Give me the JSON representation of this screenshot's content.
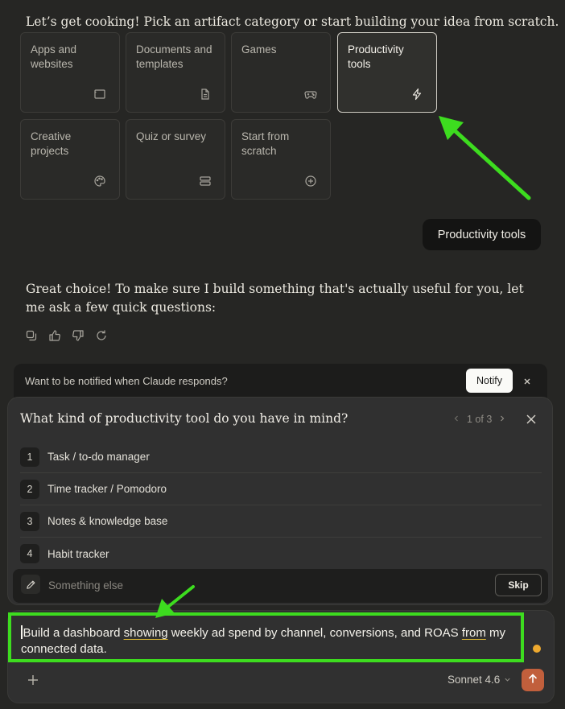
{
  "intro": "Let’s get cooking! Pick an artifact category or start building your idea from scratch.",
  "categories": [
    {
      "label": "Apps and websites",
      "icon": "window-icon"
    },
    {
      "label": "Documents and templates",
      "icon": "document-icon"
    },
    {
      "label": "Games",
      "icon": "gamepad-icon"
    },
    {
      "label": "Productivity tools",
      "icon": "lightning-icon",
      "selected": true
    },
    {
      "label": "Creative projects",
      "icon": "palette-icon"
    },
    {
      "label": "Quiz or survey",
      "icon": "list-icon"
    },
    {
      "label": "Start from scratch",
      "icon": "plus-circle-icon"
    }
  ],
  "user_message": "Productivity tools",
  "assistant_reply": "Great choice! To make sure I build something that's actually useful for you, let me ask a few quick questions:",
  "message_actions": [
    "copy-icon",
    "thumbs-up-icon",
    "thumbs-down-icon",
    "retry-icon"
  ],
  "notify": {
    "text": "Want to be notified when Claude responds?",
    "button": "Notify"
  },
  "question": {
    "title": "What kind of productivity tool do you have in mind?",
    "pager": "1 of 3",
    "options": [
      {
        "num": "1",
        "label": "Task / to-do manager"
      },
      {
        "num": "2",
        "label": "Time tracker / Pomodoro"
      },
      {
        "num": "3",
        "label": "Notes & knowledge base"
      },
      {
        "num": "4",
        "label": "Habit tracker"
      }
    ],
    "else_placeholder": "Something else",
    "skip": "Skip"
  },
  "composer": {
    "text_parts": [
      "Build a dashboard ",
      "showing",
      " weekly ad spend by channel, conversions, and ROAS ",
      "from",
      " my connected data."
    ],
    "model": "Sonnet 4.6"
  },
  "colors": {
    "accent_send": "#c15f3c",
    "annotation_green": "#3ddc1f",
    "status_dot": "#eea92f"
  }
}
